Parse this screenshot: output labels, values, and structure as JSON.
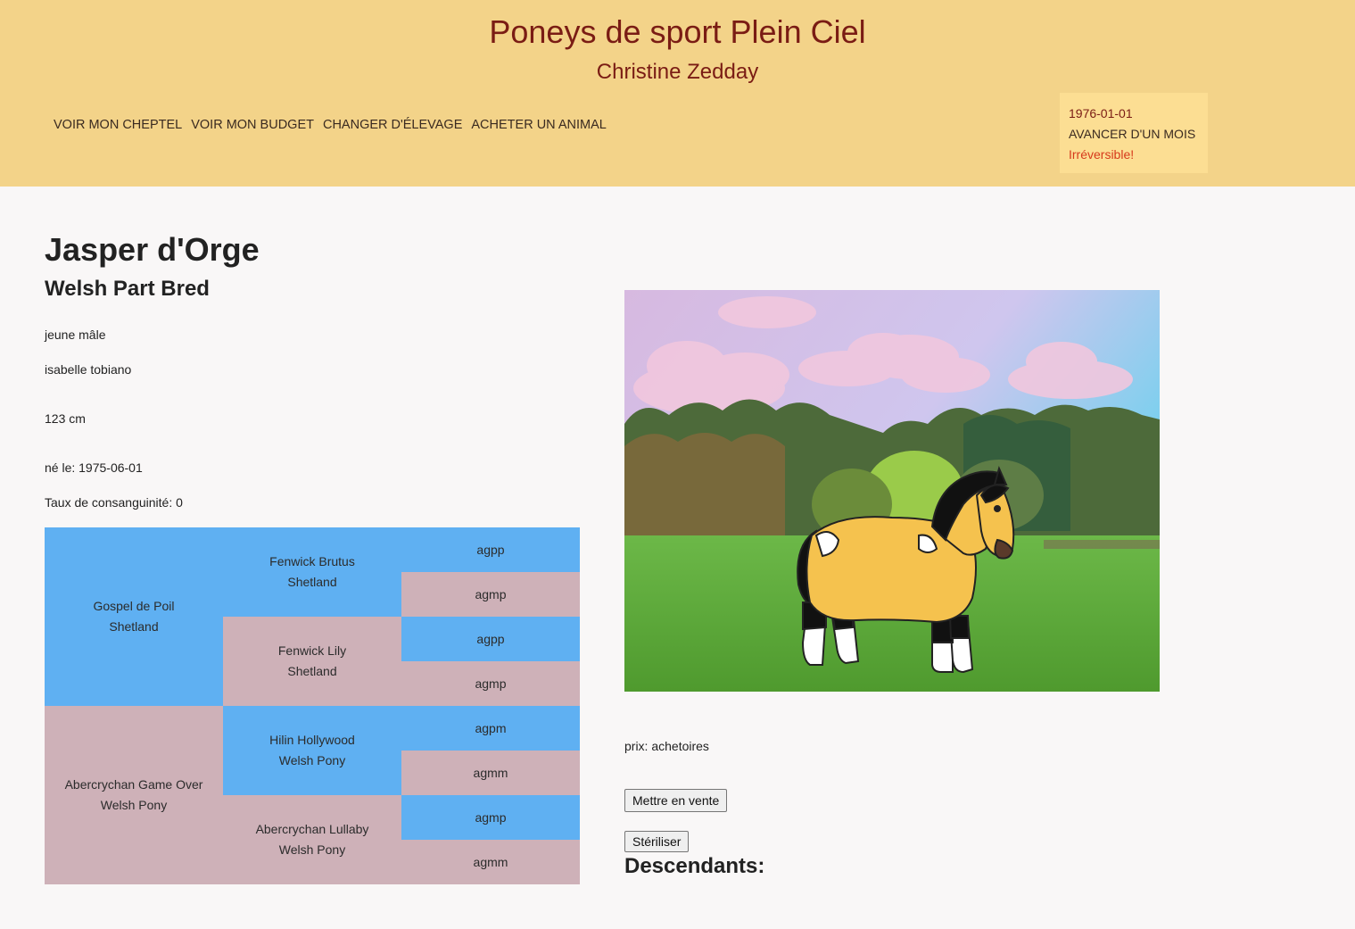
{
  "header": {
    "title": "Poneys de sport Plein Ciel",
    "subtitle": "Christine Zedday",
    "nav": [
      "VOIR MON CHEPTEL",
      "VOIR MON BUDGET",
      "CHANGER D'ÉLEVAGE",
      "ACHETER UN ANIMAL"
    ]
  },
  "date_panel": {
    "date": "1976-01-01",
    "advance_label": "AVANCER D'UN MOIS",
    "warning": "Irréversible!"
  },
  "animal": {
    "name": "Jasper d'Orge",
    "breed": "Welsh Part Bred",
    "age_sex": "jeune mâle",
    "coat": "isabelle tobiano",
    "height": "123 cm",
    "birth": "né le: 1975-06-01",
    "inbreeding": "Taux de consanguinité: 0",
    "price": "prix: achetoires"
  },
  "pedigree": {
    "sire": {
      "name": "Gospel de Poil",
      "breed": "Shetland"
    },
    "dam": {
      "name": "Abercrychan Game Over",
      "breed": "Welsh Pony"
    },
    "grandparents": [
      {
        "name": "Fenwick Brutus",
        "breed": "Shetland"
      },
      {
        "name": "Fenwick Lily",
        "breed": "Shetland"
      },
      {
        "name": "Hilin Hollywood",
        "breed": "Welsh Pony"
      },
      {
        "name": "Abercrychan Lullaby",
        "breed": "Welsh Pony"
      }
    ],
    "great_grandparents": [
      "agpp",
      "agmp",
      "agpp",
      "agmp",
      "agpm",
      "agmm",
      "agmp",
      "agmm"
    ]
  },
  "actions": {
    "sell_label": "Mettre en vente",
    "sterilize_label": "Stériliser"
  },
  "descendants_title": "Descendants:",
  "colors": {
    "header_bg": "#f3d389",
    "title_color": "#7a1c14",
    "male_cell": "#5fb0f2",
    "female_cell": "#ceb1b8",
    "warning": "#d63a1c"
  }
}
